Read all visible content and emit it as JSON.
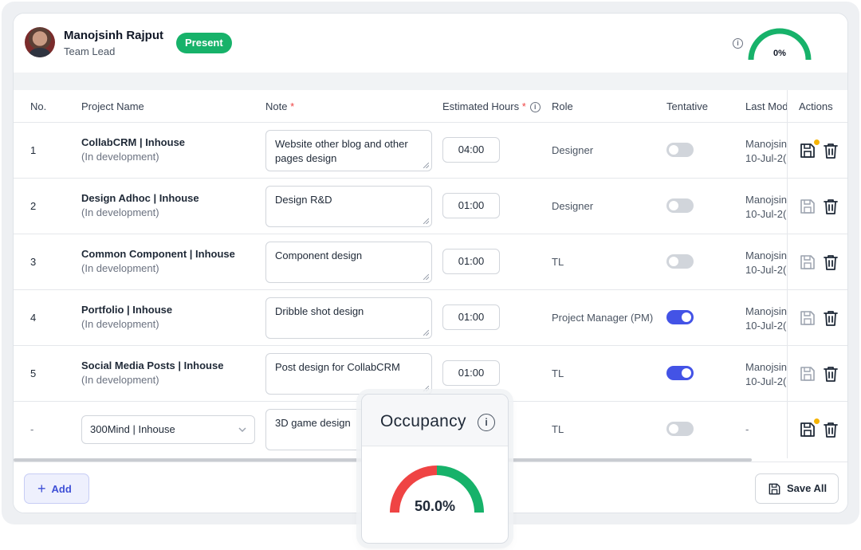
{
  "user": {
    "name": "Manojsinh Rajput",
    "role": "Team Lead",
    "status": "Present",
    "progress_label": "0%",
    "progress_fraction": 0
  },
  "table": {
    "headers": {
      "no": "No.",
      "project": "Project Name",
      "note": "Note",
      "hours": "Estimated Hours",
      "role": "Role",
      "tentative": "Tentative",
      "modified": "Last Mod",
      "actions": "Actions"
    },
    "required_mark": "*",
    "rows": [
      {
        "no": "1",
        "project": "CollabCRM | Inhouse",
        "status": "(In development)",
        "note": "Website other blog and other pages design",
        "hours": "04:00",
        "role": "Designer",
        "tentative": false,
        "modified_by": "Manojsin",
        "modified_date": "10-Jul-2(",
        "unsaved": true
      },
      {
        "no": "2",
        "project": "Design Adhoc | Inhouse",
        "status": "(In development)",
        "note": "Design R&D",
        "hours": "01:00",
        "role": "Designer",
        "tentative": false,
        "modified_by": "Manojsin",
        "modified_date": "10-Jul-2(",
        "unsaved": false
      },
      {
        "no": "3",
        "project": "Common Component | Inhouse",
        "status": "(In development)",
        "note": "Component design",
        "hours": "01:00",
        "role": "TL",
        "tentative": false,
        "modified_by": "Manojsin",
        "modified_date": "10-Jul-2(",
        "unsaved": false
      },
      {
        "no": "4",
        "project": "Portfolio | Inhouse",
        "status": "(In development)",
        "note": "Dribble shot design",
        "hours": "01:00",
        "role": "Project Manager (PM)",
        "tentative": true,
        "modified_by": "Manojsin",
        "modified_date": "10-Jul-2(",
        "unsaved": false
      },
      {
        "no": "5",
        "project": "Social Media Posts | Inhouse",
        "status": "(In development)",
        "note": "Post design for CollabCRM",
        "hours": "01:00",
        "role": "TL",
        "tentative": true,
        "modified_by": "Manojsin",
        "modified_date": "10-Jul-2(",
        "unsaved": false
      }
    ],
    "new_row": {
      "no": "-",
      "project_select": "300Mind | Inhouse",
      "note": "3D game design",
      "role": "TL",
      "tentative": false,
      "modified": "-",
      "unsaved": true
    }
  },
  "footer": {
    "add_label": "Add",
    "save_all_label": "Save All"
  },
  "occupancy": {
    "title": "Occupancy",
    "value_label": "50.0%",
    "fraction": 0.5
  },
  "colors": {
    "present_green": "#17b26a",
    "toggle_on": "#4353e6",
    "gauge_red": "#ef4444",
    "gauge_green": "#17b26a",
    "unsaved_dot": "#f5b301"
  }
}
